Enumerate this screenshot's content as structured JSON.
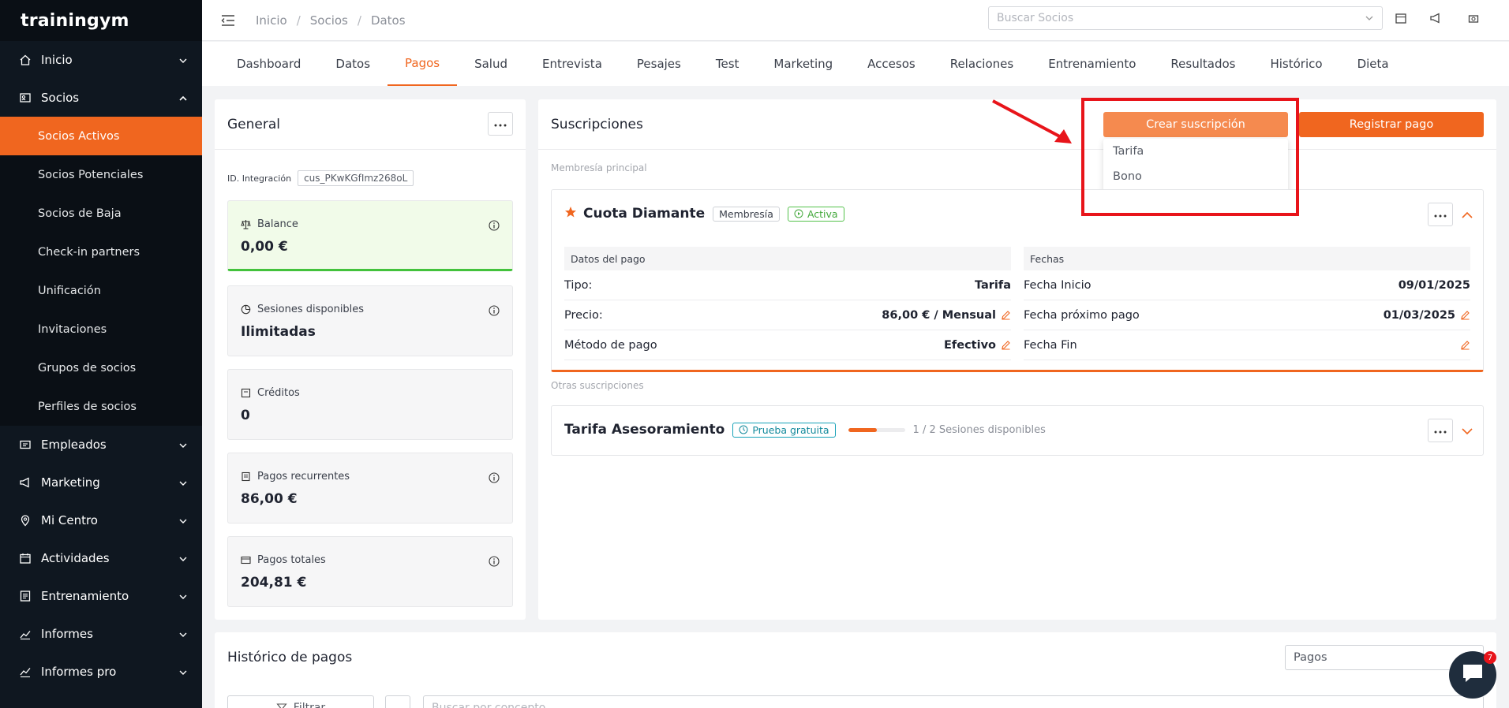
{
  "app": {
    "logo": "trainingym"
  },
  "sidebar": {
    "items": [
      {
        "label": "Inicio",
        "icon": "home-icon"
      },
      {
        "label": "Socios",
        "icon": "users-card-icon"
      },
      {
        "label": "Empleados",
        "icon": "id-card-icon"
      },
      {
        "label": "Marketing",
        "icon": "megaphone-icon"
      },
      {
        "label": "Mi Centro",
        "icon": "location-icon"
      },
      {
        "label": "Actividades",
        "icon": "calendar-icon"
      },
      {
        "label": "Entrenamiento",
        "icon": "list-icon"
      },
      {
        "label": "Informes",
        "icon": "chart-icon"
      },
      {
        "label": "Informes pro",
        "icon": "chart-pro-icon"
      }
    ],
    "subitems": [
      "Socios Activos",
      "Socios Potenciales",
      "Socios de Baja",
      "Check-in partners",
      "Unificación",
      "Invitaciones",
      "Grupos de socios",
      "Perfiles de socios"
    ]
  },
  "breadcrumb": [
    "Inicio",
    "Socios",
    "Datos"
  ],
  "search": {
    "placeholder": "Buscar Socios"
  },
  "tabs": [
    "Dashboard",
    "Datos",
    "Pagos",
    "Salud",
    "Entrevista",
    "Pesajes",
    "Test",
    "Marketing",
    "Accesos",
    "Relaciones",
    "Entrenamiento",
    "Resultados",
    "Histórico",
    "Dieta"
  ],
  "general": {
    "title": "General",
    "id_label": "ID. Integración",
    "id_value": "cus_PKwKGfImz268oL",
    "stats": [
      {
        "label": "Balance",
        "value": "0,00 €"
      },
      {
        "label": "Sesiones disponibles",
        "value": "Ilimitadas"
      },
      {
        "label": "Créditos",
        "value": "0"
      },
      {
        "label": "Pagos recurrentes",
        "value": "86,00 €"
      },
      {
        "label": "Pagos totales",
        "value": "204,81 €"
      }
    ]
  },
  "subs": {
    "title": "Suscripciones",
    "crear_label": "Crear suscripción",
    "registrar_label": "Registrar pago",
    "dropdown": [
      "Tarifa",
      "Bono"
    ],
    "main_section_label": "Membresía principal",
    "main": {
      "name": "Cuota Diamante",
      "tag": "Membresía",
      "status": "Activa",
      "pago_header": "Datos del pago",
      "fechas_header": "Fechas",
      "pago_rows": [
        {
          "k": "Tipo:",
          "v": "Tarifa"
        },
        {
          "k": "Precio:",
          "v": "86,00 € / Mensual"
        },
        {
          "k": "Método de pago",
          "v": "Efectivo"
        }
      ],
      "fecha_rows": [
        {
          "k": "Fecha Inicio",
          "v": "09/01/2025"
        },
        {
          "k": "Fecha próximo pago",
          "v": "01/03/2025"
        },
        {
          "k": "Fecha Fin",
          "v": ""
        }
      ]
    },
    "other_section_label": "Otras suscripciones",
    "other": {
      "name": "Tarifa Asesoramiento",
      "tag": "Prueba gratuita",
      "progress": 0.5,
      "sessions": "1 / 2 Sesiones disponibles"
    }
  },
  "historico": {
    "title": "Histórico de pagos",
    "select_value": "Pagos",
    "filter_label": "Filtrar",
    "search_placeholder": "Buscar por concepto"
  },
  "chat": {
    "badge": "7"
  },
  "colors": {
    "accent": "#f0661f",
    "sidebar": "#0f1720",
    "annotation": "#e8141a",
    "success": "#43c23c"
  }
}
